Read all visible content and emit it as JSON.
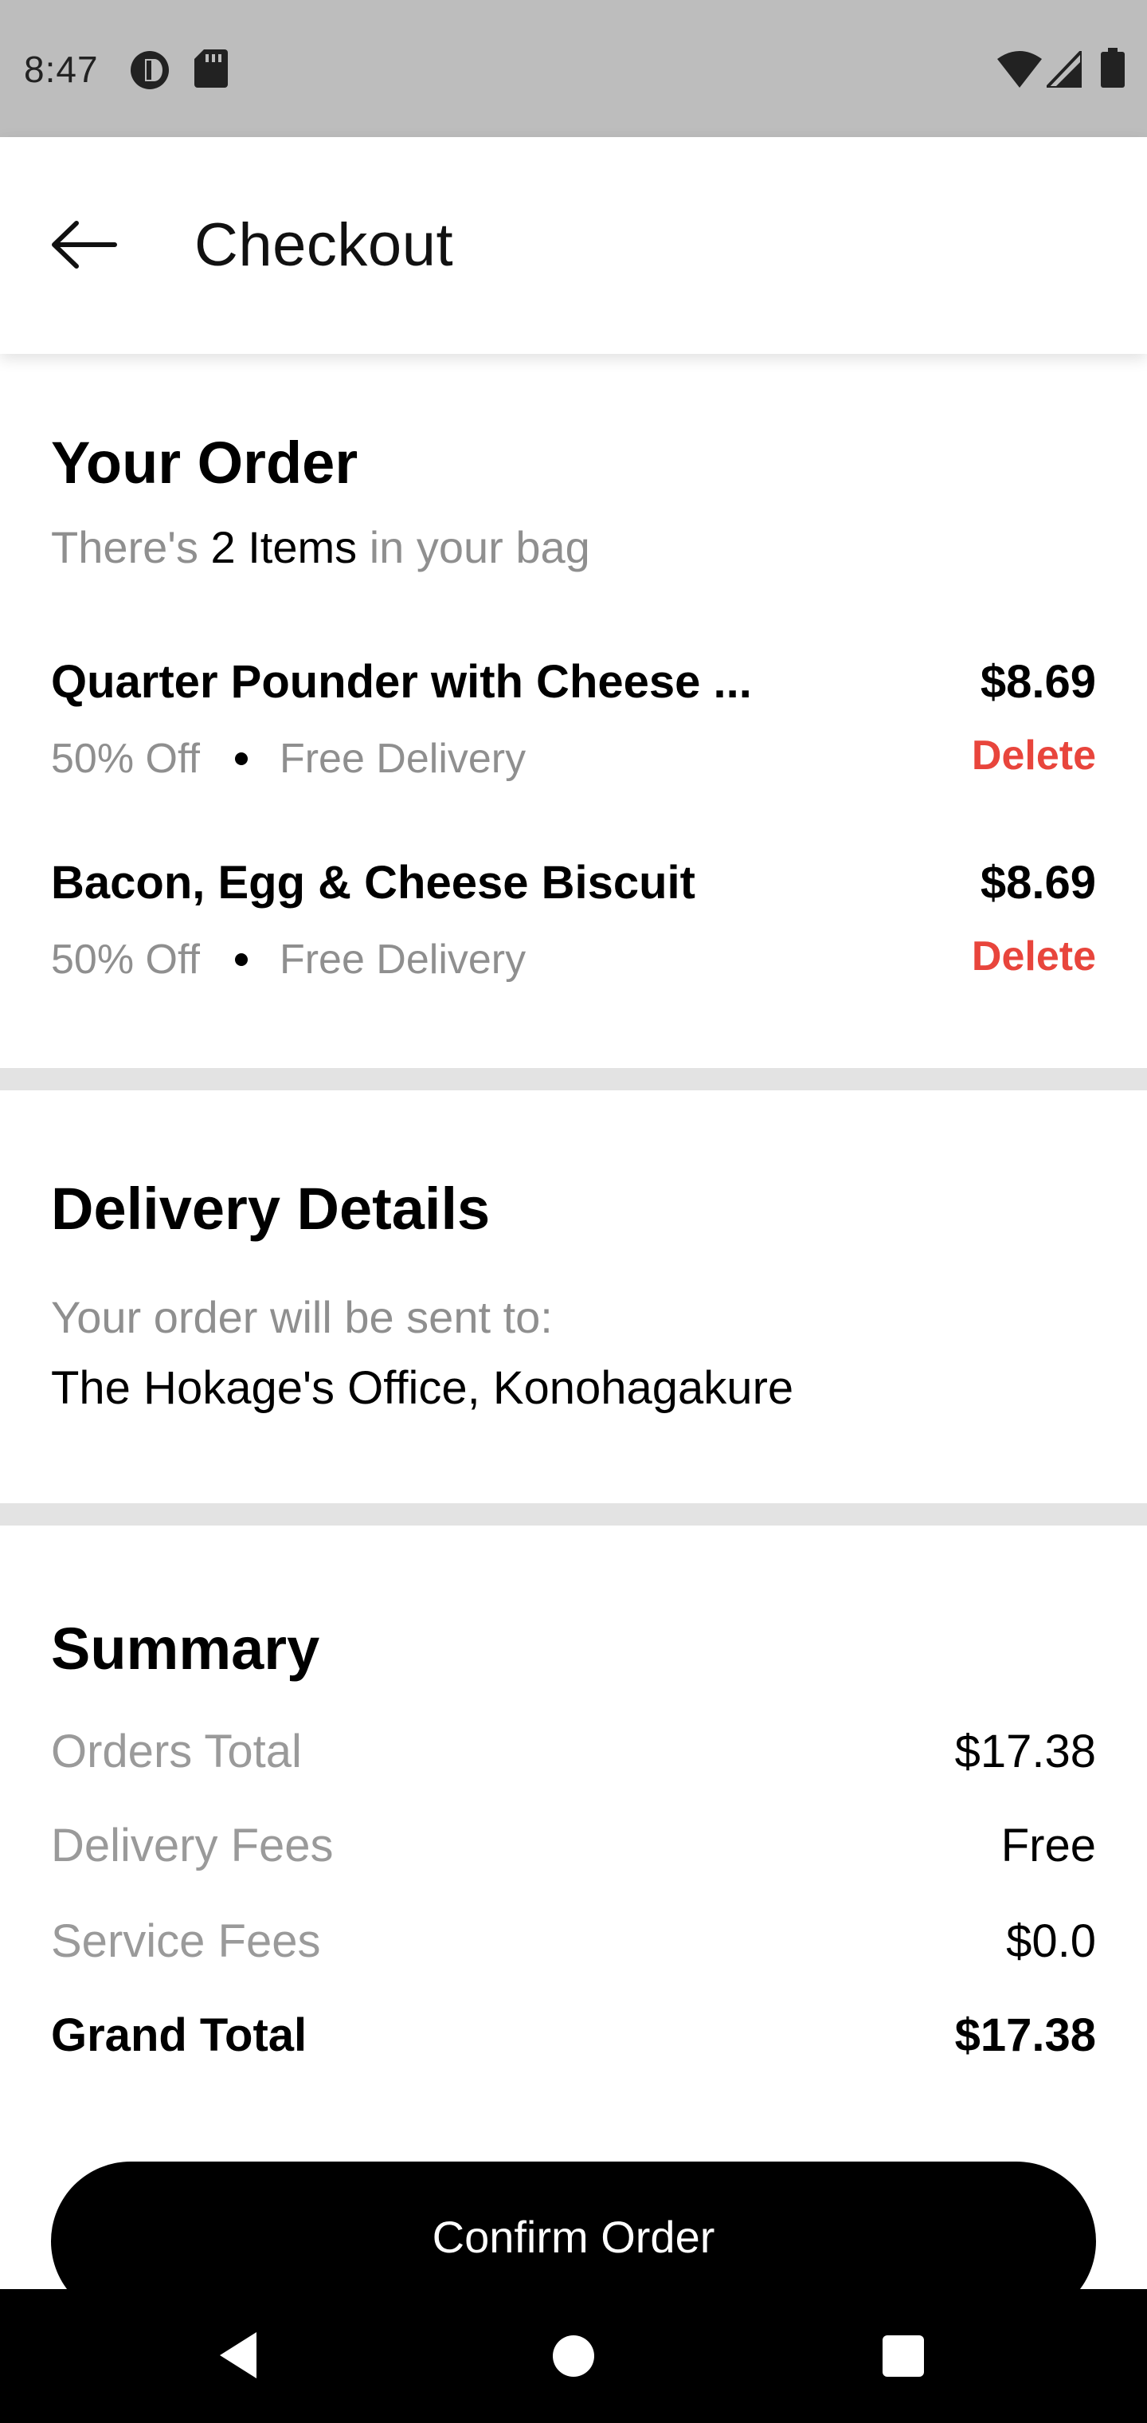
{
  "status_bar": {
    "time": "8:47",
    "icons": [
      "data-saver-icon",
      "sd-card-icon",
      "wifi-icon",
      "signal-icon",
      "battery-icon"
    ]
  },
  "header": {
    "title": "Checkout",
    "back_icon": "arrow-left-icon"
  },
  "order": {
    "heading": "Your Order",
    "count_prefix": "There's",
    "count_bold": "2 Items",
    "count_suffix": "in your bag",
    "items": [
      {
        "name": "Quarter Pounder with Cheese ...",
        "discount": "50% Off",
        "delivery": "Free Delivery",
        "price": "$8.69",
        "delete_label": "Delete"
      },
      {
        "name": "Bacon, Egg & Cheese Biscuit",
        "discount": "50% Off",
        "delivery": "Free Delivery",
        "price": "$8.69",
        "delete_label": "Delete"
      }
    ]
  },
  "delivery": {
    "heading": "Delivery Details",
    "label": "Your order will be sent to:",
    "address": "The Hokage's Office, Konohagakure"
  },
  "summary": {
    "heading": "Summary",
    "rows": [
      {
        "label": "Orders Total",
        "value": "$17.38"
      },
      {
        "label": "Delivery Fees",
        "value": "Free"
      },
      {
        "label": "Service Fees",
        "value": "$0.0"
      },
      {
        "label": "Grand Total",
        "value": "$17.38"
      }
    ]
  },
  "confirm_button": {
    "label": "Confirm Order"
  },
  "nav_bar": {
    "icons": [
      "nav-back-icon",
      "nav-home-icon",
      "nav-recents-icon"
    ]
  },
  "colors": {
    "accent_delete": "#e8453c",
    "status_bar": "#bdbdbd",
    "muted_text": "#8f8f8f",
    "divider": "#e3e3e3"
  }
}
